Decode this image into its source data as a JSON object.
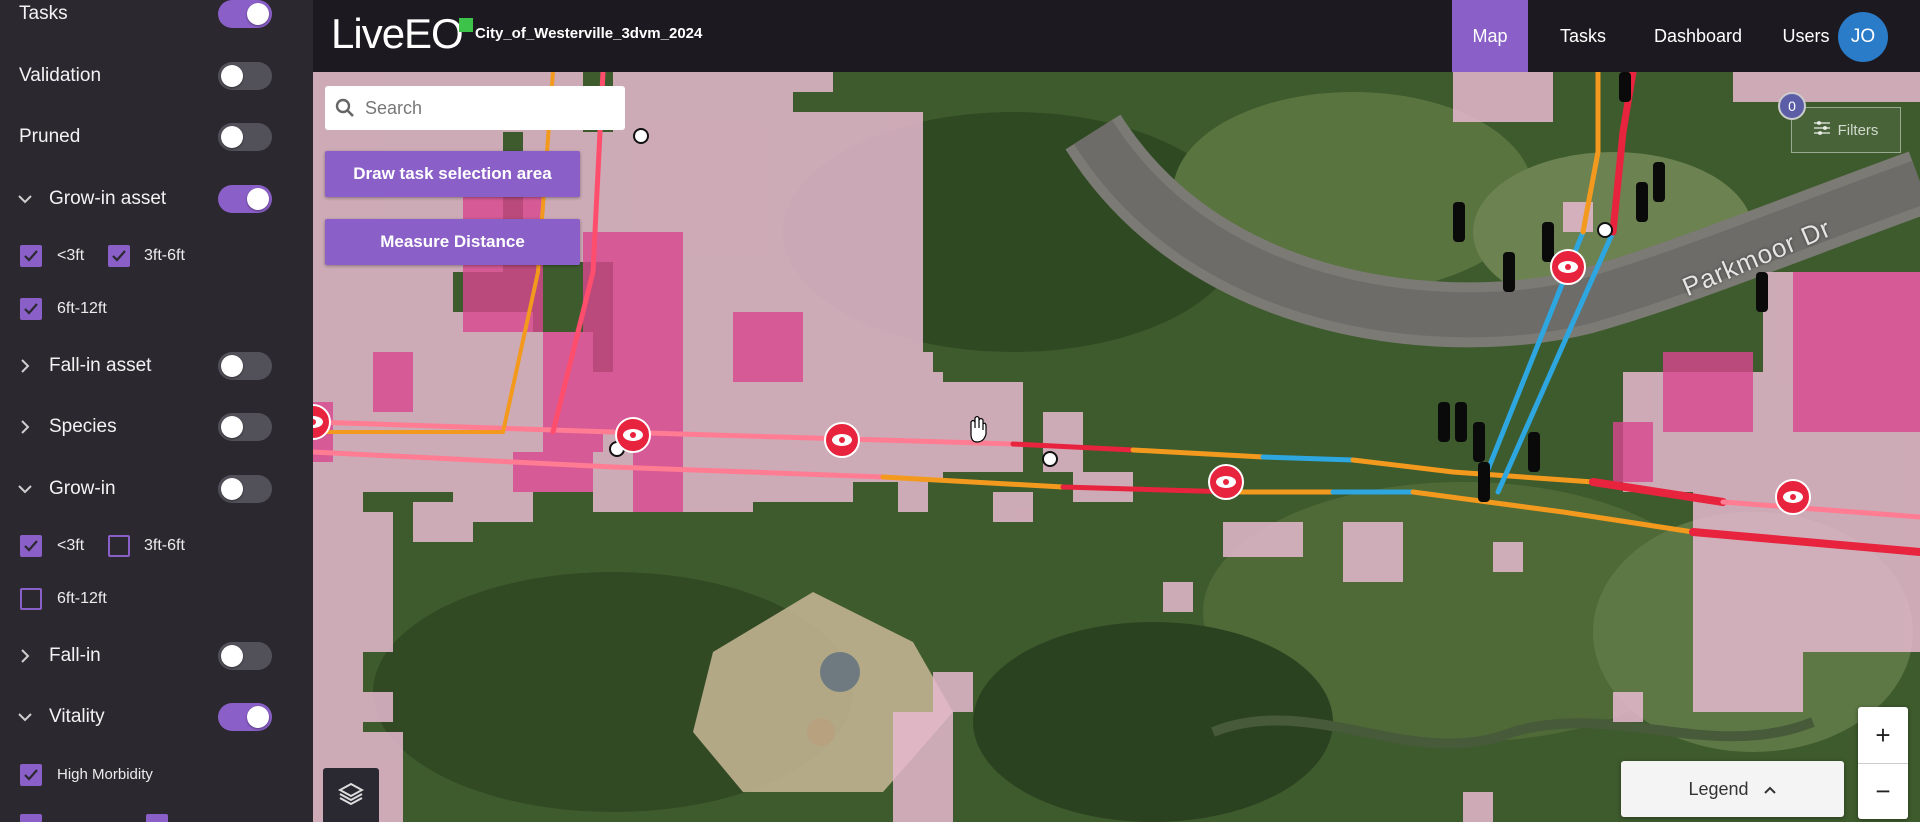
{
  "sidebar": {
    "layers": [
      {
        "id": "tasks",
        "label": "Tasks",
        "on": true,
        "expandable": false
      },
      {
        "id": "validation",
        "label": "Validation",
        "on": false,
        "expandable": false
      },
      {
        "id": "pruned",
        "label": "Pruned",
        "on": false,
        "expandable": false
      },
      {
        "id": "grow_in_asset",
        "label": "Grow-in asset",
        "on": true,
        "expanded": true
      },
      {
        "id": "fall_in_asset",
        "label": "Fall-in asset",
        "on": false,
        "expanded": false
      },
      {
        "id": "species",
        "label": "Species",
        "on": false,
        "expanded": false
      },
      {
        "id": "grow_in",
        "label": "Grow-in",
        "on": false,
        "expanded": true
      },
      {
        "id": "fall_in",
        "label": "Fall-in",
        "on": false,
        "expanded": false
      },
      {
        "id": "vitality",
        "label": "Vitality",
        "on": true,
        "expanded": true
      }
    ],
    "grow_in_asset_options": [
      {
        "label": "<3ft",
        "checked": true
      },
      {
        "label": "3ft-6ft",
        "checked": true
      },
      {
        "label": "6ft-12ft",
        "checked": true
      }
    ],
    "grow_in_options": [
      {
        "label": "<3ft",
        "checked": true
      },
      {
        "label": "3ft-6ft",
        "checked": false
      },
      {
        "label": "6ft-12ft",
        "checked": false
      }
    ],
    "vitality_options": [
      {
        "label": "High Morbidity",
        "checked": true
      }
    ]
  },
  "header": {
    "logo": "LiveEO",
    "project": "City_of_Westerville_3dvm_2024",
    "nav": [
      "Map",
      "Tasks",
      "Dashboard",
      "Users"
    ],
    "active_nav": "Map",
    "avatar": "JO"
  },
  "map": {
    "search_placeholder": "Search",
    "draw_button": "Draw task selection area",
    "measure_button": "Measure Distance",
    "filters_label": "Filters",
    "filter_count": "0",
    "legend_label": "Legend",
    "zoom_in": "+",
    "zoom_out": "−",
    "street_label": "Parkmoor Dr"
  },
  "colors": {
    "accent": "#8a5fc7",
    "pink_cells": "#e9b8cf",
    "magenta_cells": "#d6468e",
    "line_red": "#e8233d",
    "line_orange": "#f39a1e",
    "line_blue": "#2ea6df"
  }
}
